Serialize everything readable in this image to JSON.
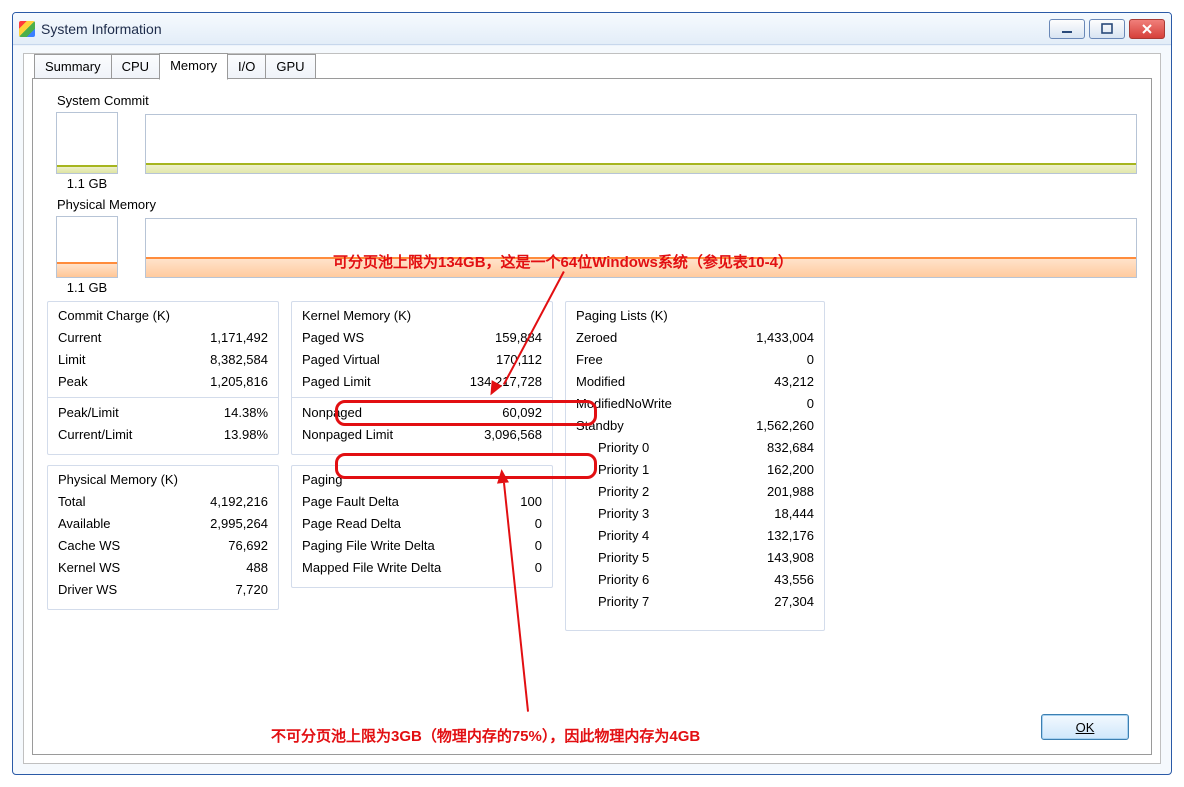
{
  "window": {
    "title": "System Information"
  },
  "tabs": {
    "t0": "Summary",
    "t1": "CPU",
    "t2": "Memory",
    "t3": "I/O",
    "t4": "GPU",
    "active": 2
  },
  "graphs": {
    "commit_label": "System Commit",
    "commit_value": "1.1 GB",
    "phys_label": "Physical Memory",
    "phys_value": "1.1 GB"
  },
  "commit": {
    "title": "Commit Charge (K)",
    "current_l": "Current",
    "current_v": "1,171,492",
    "limit_l": "Limit",
    "limit_v": "8,382,584",
    "peak_l": "Peak",
    "peak_v": "1,205,816",
    "peaklimit_l": "Peak/Limit",
    "peaklimit_v": "14.38%",
    "curlimit_l": "Current/Limit",
    "curlimit_v": "13.98%"
  },
  "physmem": {
    "title": "Physical Memory (K)",
    "total_l": "Total",
    "total_v": "4,192,216",
    "avail_l": "Available",
    "avail_v": "2,995,264",
    "cache_l": "Cache WS",
    "cache_v": "76,692",
    "kernel_l": "Kernel WS",
    "kernel_v": "488",
    "driver_l": "Driver WS",
    "driver_v": "7,720"
  },
  "kernel": {
    "title": "Kernel Memory (K)",
    "pws_l": "Paged WS",
    "pws_v": "159,884",
    "pv_l": "Paged Virtual",
    "pv_v": "170,112",
    "pl_l": "Paged Limit",
    "pl_v": "134,217,728",
    "np_l": "Nonpaged",
    "np_v": "60,092",
    "npl_l": "Nonpaged Limit",
    "npl_v": "3,096,568"
  },
  "paging": {
    "title": "Paging",
    "pfd_l": "Page Fault Delta",
    "pfd_v": "100",
    "prd_l": "Page Read Delta",
    "prd_v": "0",
    "pfwd_l": "Paging File Write Delta",
    "pfwd_v": "0",
    "mfwd_l": "Mapped File Write Delta",
    "mfwd_v": "0"
  },
  "lists": {
    "title": "Paging Lists (K)",
    "zero_l": "Zeroed",
    "zero_v": "1,433,004",
    "free_l": "Free",
    "free_v": "0",
    "mod_l": "Modified",
    "mod_v": "43,212",
    "mnw_l": "ModifiedNoWrite",
    "mnw_v": "0",
    "standby_l": "Standby",
    "standby_v": "1,562,260",
    "p0_l": "Priority 0",
    "p0_v": "832,684",
    "p1_l": "Priority 1",
    "p1_v": "162,200",
    "p2_l": "Priority 2",
    "p2_v": "201,988",
    "p3_l": "Priority 3",
    "p3_v": "18,444",
    "p4_l": "Priority 4",
    "p4_v": "132,176",
    "p5_l": "Priority 5",
    "p5_v": "143,908",
    "p6_l": "Priority 6",
    "p6_v": "43,556",
    "p7_l": "Priority 7",
    "p7_v": "27,304"
  },
  "annot": {
    "top": "可分页池上限为134GB，这是一个64位Windows系统（参见表10-4）",
    "bottom": "不可分页池上限为3GB（物理内存的75%），因此物理内存为4GB"
  },
  "buttons": {
    "ok": "OK"
  }
}
